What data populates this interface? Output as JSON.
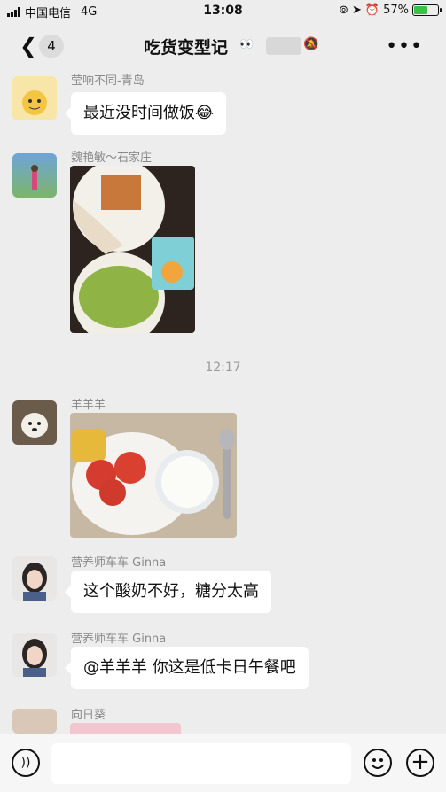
{
  "statusbar": {
    "carrier": "中国电信",
    "network": "4G",
    "time": "13:08",
    "battery": "57%",
    "battery_level": 0.57
  },
  "navbar": {
    "back_icon": "chevron-left-icon",
    "unread_count": "4",
    "title": "吃货变型记",
    "title_suffix": "👀",
    "more_icon": "more-icon"
  },
  "messages": [
    {
      "sender": "莹响不同-青岛",
      "text": "最近没时间做饭😂"
    },
    {
      "sender": "魏艳敏～石家庄"
    },
    {
      "sender": "羊羊羊"
    },
    {
      "sender": "营养师车车 Ginna",
      "text": "这个酸奶不好，糖分太高"
    },
    {
      "sender": "营养师车车 Ginna",
      "text": "@羊羊羊 你这是低卡日午餐吧"
    },
    {
      "sender": "向日葵"
    }
  ],
  "timestamp": "12:17",
  "inputbar": {
    "voice_icon": "voice-icon",
    "emoji_icon": "emoji-icon",
    "add_icon": "plus-icon"
  }
}
